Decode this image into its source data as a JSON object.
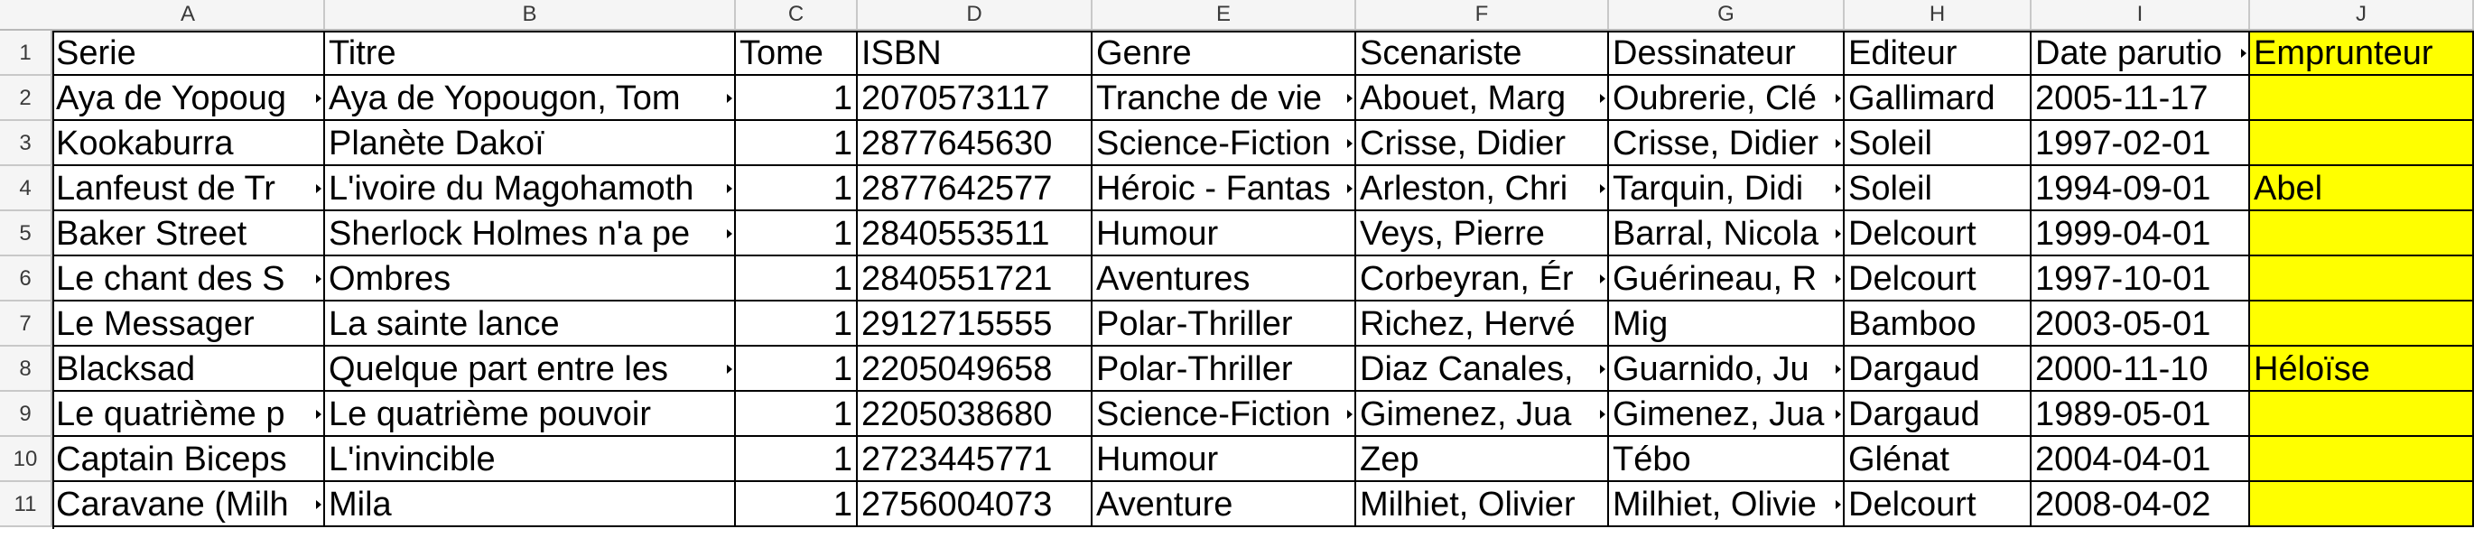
{
  "sheet": {
    "column_headers": [
      "A",
      "B",
      "C",
      "D",
      "E",
      "F",
      "G",
      "H",
      "I",
      "J"
    ],
    "row_headers": [
      "1",
      "2",
      "3",
      "4",
      "5",
      "6",
      "7",
      "8",
      "9",
      "10",
      "11"
    ],
    "rows": [
      [
        "Serie",
        "Titre",
        "Tome",
        "ISBN",
        "Genre",
        "Scenariste",
        "Dessinateur",
        "Editeur",
        "Date parutio",
        "Emprunteur"
      ],
      [
        "Aya de Yopoug",
        "Aya de Yopougon, Tom",
        "1",
        "2070573117",
        "Tranche de vie",
        "Abouet, Marg",
        "Oubrerie, Clé",
        "Gallimard",
        "2005-11-17",
        ""
      ],
      [
        "Kookaburra",
        "Planète Dakoï",
        "1",
        "2877645630",
        "Science-Fiction",
        "Crisse, Didier",
        "Crisse, Didier",
        "Soleil",
        "1997-02-01",
        ""
      ],
      [
        "Lanfeust de Tr",
        "L'ivoire du Magohamoth",
        "1",
        "2877642577",
        "Héroic - Fantas",
        "Arleston, Chri",
        "Tarquin, Didi",
        "Soleil",
        "1994-09-01",
        "Abel"
      ],
      [
        "Baker Street",
        "Sherlock Holmes n'a pe",
        "1",
        "2840553511",
        "Humour",
        "Veys, Pierre",
        "Barral, Nicola",
        "Delcourt",
        "1999-04-01",
        ""
      ],
      [
        "Le chant des S",
        "Ombres",
        "1",
        "2840551721",
        "Aventures",
        "Corbeyran, Ér",
        "Guérineau, R",
        "Delcourt",
        "1997-10-01",
        ""
      ],
      [
        "Le Messager",
        "La sainte lance",
        "1",
        "2912715555",
        "Polar-Thriller",
        "Richez, Hervé",
        "Mig",
        "Bamboo",
        "2003-05-01",
        ""
      ],
      [
        "Blacksad",
        "Quelque part entre les",
        "1",
        "2205049658",
        "Polar-Thriller",
        "Diaz Canales,",
        "Guarnido, Ju",
        "Dargaud",
        "2000-11-10",
        "Héloïse"
      ],
      [
        "Le quatrième p",
        "Le quatrième pouvoir",
        "1",
        "2205038680",
        "Science-Fiction",
        "Gimenez, Jua",
        "Gimenez, Jua",
        "Dargaud",
        "1989-05-01",
        ""
      ],
      [
        "Captain Biceps",
        "L'invincible",
        "1",
        "2723445771",
        "Humour",
        "Zep",
        "Tébo",
        "Glénat",
        "2004-04-01",
        ""
      ],
      [
        "Caravane (Milh",
        "Mila",
        "1",
        "2756004073",
        "Aventure",
        "Milhiet, Olivier",
        "Milhiet, Olivie",
        "Delcourt",
        "2008-04-02",
        ""
      ]
    ]
  },
  "colors": {
    "highlight": "#ffff00",
    "header_bg": "#f5f5f5",
    "grid": "#000000"
  }
}
